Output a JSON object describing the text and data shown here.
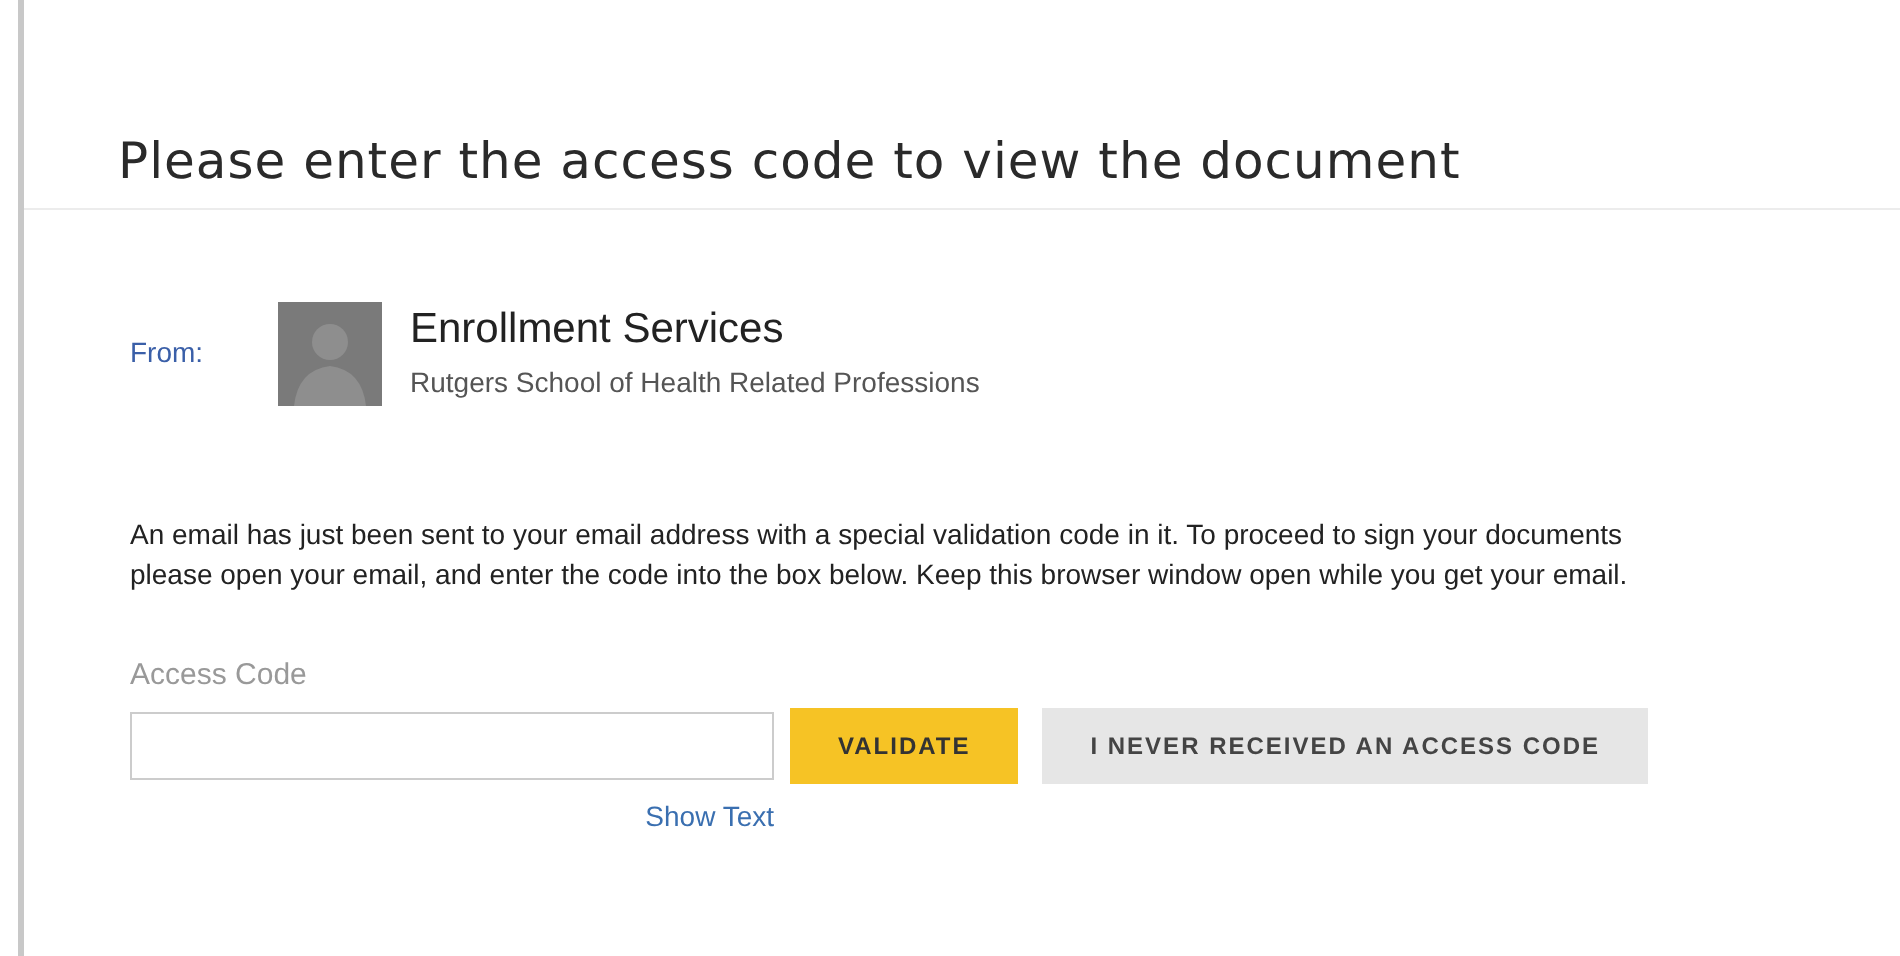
{
  "heading": "Please enter the access code to view the document",
  "sender": {
    "label": "From:",
    "name": "Enrollment Services",
    "organization": "Rutgers School of Health Related Professions"
  },
  "message": "An email has just been sent to your email address with a special validation code in it. To proceed to sign your documents please open your email, and enter the code into the box below. Keep this browser window open while you get your email.",
  "access_code": {
    "label": "Access Code"
  },
  "buttons": [
    {
      "kind": "primary",
      "label": "VALIDATE"
    },
    {
      "kind": "secondary",
      "label": "I NEVER RECEIVED AN ACCESS CODE"
    }
  ],
  "show_text_link": "Show Text"
}
